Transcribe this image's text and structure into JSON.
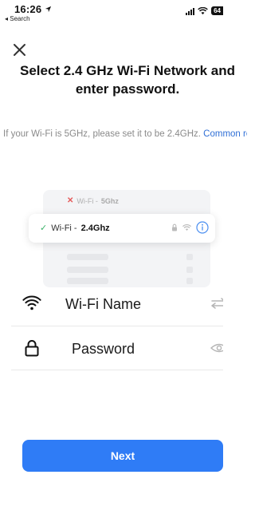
{
  "status_bar": {
    "time": "16:26",
    "back_label": "◂ Search",
    "battery": "64"
  },
  "header": {
    "title": "Select 2.4 GHz Wi-Fi Network and enter password.",
    "subtitle_text": "If your Wi-Fi is 5GHz, please set it to be 2.4GHz. ",
    "subtitle_link": "Common router setting method"
  },
  "illustration": {
    "row_5g_prefix": "Wi-Fi - ",
    "row_5g_band": "5Ghz",
    "row_24_prefix": "Wi-Fi - ",
    "row_24_band": "2.4Ghz"
  },
  "form": {
    "wifi_name_label": "Wi-Fi Name",
    "password_label": "Password"
  },
  "actions": {
    "next_label": "Next"
  },
  "colors": {
    "accent": "#2f7cf6",
    "link": "#2f6fd6",
    "check": "#3bb26a",
    "error": "#e55a5a"
  }
}
